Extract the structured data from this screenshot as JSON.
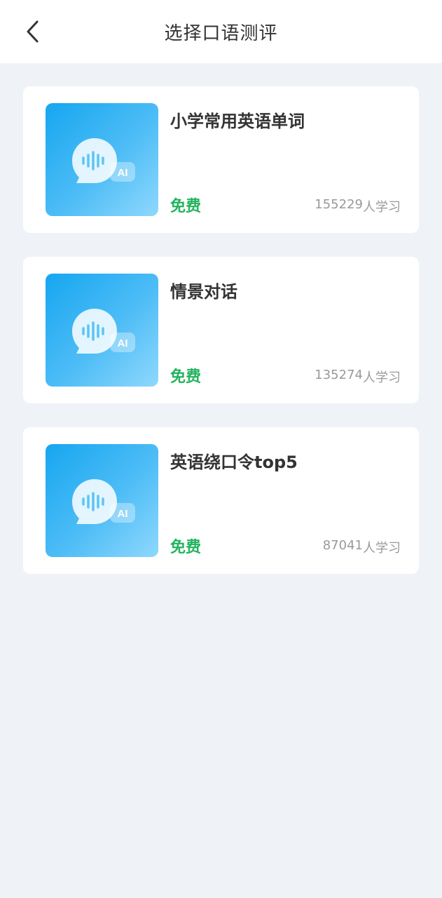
{
  "header": {
    "title": "选择口语测评",
    "back_icon": "chevron-left-icon"
  },
  "courses": [
    {
      "title": "小学常用英语单词",
      "price": "免费",
      "learners": "155229",
      "learners_suffix": "人学习",
      "thumb_icon": "ai-voice-bubble-icon"
    },
    {
      "title": "情景对话",
      "price": "免费",
      "learners": "135274",
      "learners_suffix": "人学习",
      "thumb_icon": "ai-voice-bubble-icon"
    },
    {
      "title": "英语绕口令top5",
      "price": "免费",
      "learners": "87041",
      "learners_suffix": "人学习",
      "thumb_icon": "ai-voice-bubble-icon"
    }
  ],
  "colors": {
    "accent_green": "#22b35e",
    "thumb_blue": "#16a6f0",
    "background": "#eff3f7"
  }
}
